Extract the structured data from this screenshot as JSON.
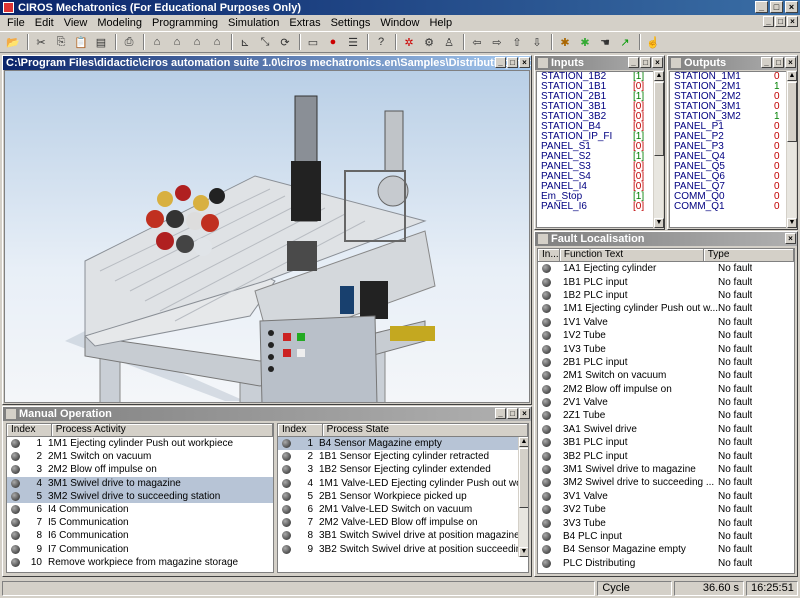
{
  "app": {
    "title": "CIROS Mechatronics (For Educational Purposes Only)"
  },
  "menu": [
    "File",
    "Edit",
    "View",
    "Modeling",
    "Programming",
    "Simulation",
    "Extras",
    "Settings",
    "Window",
    "Help"
  ],
  "toolbar_icons": [
    "open-folder-icon",
    "cut-icon",
    "copy-icon",
    "paste-icon",
    "paste-special-icon",
    "print-icon",
    "house-icon",
    "house-up-icon",
    "house-run-icon",
    "house-active-icon",
    "axes-icon",
    "axes-scale-icon",
    "axes-rotate-icon",
    "doc-icon",
    "stop-icon",
    "doc-list-icon",
    "help-pointer-icon",
    "robot-arm-icon",
    "gripper-icon",
    "robot-icon",
    "arrow-left-icon",
    "arrow-right-icon",
    "arrow-up-icon",
    "arrow-down-icon",
    "bug-icon",
    "bug-green-icon",
    "hand-wave-icon",
    "vector-icon",
    "hand-pointer-icon"
  ],
  "scene": {
    "title": "C:\\Program Files\\didactic\\ciros automation suite 1.0\\ciros mechatronics.en\\Samples\\DistributingStation..."
  },
  "inputs": {
    "title": "Inputs",
    "rows": [
      {
        "name": "STATION_1B2",
        "val": "[1]"
      },
      {
        "name": "STATION_1B1",
        "val": "[0]"
      },
      {
        "name": "STATION_2B1",
        "val": "[1]"
      },
      {
        "name": "STATION_3B1",
        "val": "[0]"
      },
      {
        "name": "STATION_3B2",
        "val": "[0]"
      },
      {
        "name": "STATION_B4",
        "val": "[0]"
      },
      {
        "name": "STATION_IP_FI",
        "val": "[1]"
      },
      {
        "name": "PANEL_S1",
        "val": "[0]"
      },
      {
        "name": "PANEL_S2",
        "val": "[1]"
      },
      {
        "name": "PANEL_S3",
        "val": "[0]"
      },
      {
        "name": "PANEL_S4",
        "val": "[0]"
      },
      {
        "name": "PANEL_I4",
        "val": "[0]"
      },
      {
        "name": "Em_Stop",
        "val": "[1]"
      },
      {
        "name": "PANEL_I6",
        "val": "[0]"
      }
    ]
  },
  "outputs": {
    "title": "Outputs",
    "rows": [
      {
        "name": "STATION_1M1",
        "val": "0"
      },
      {
        "name": "STATION_2M1",
        "val": "1"
      },
      {
        "name": "STATION_2M2",
        "val": "0"
      },
      {
        "name": "STATION_3M1",
        "val": "0"
      },
      {
        "name": "STATION_3M2",
        "val": "1"
      },
      {
        "name": "PANEL_P1",
        "val": "0"
      },
      {
        "name": "PANEL_P2",
        "val": "0"
      },
      {
        "name": "PANEL_P3",
        "val": "0"
      },
      {
        "name": "PANEL_Q4",
        "val": "0"
      },
      {
        "name": "PANEL_Q5",
        "val": "0"
      },
      {
        "name": "PANEL_Q6",
        "val": "0"
      },
      {
        "name": "PANEL_Q7",
        "val": "0"
      },
      {
        "name": "COMM_Q0",
        "val": "0"
      },
      {
        "name": "COMM_Q1",
        "val": "0"
      }
    ]
  },
  "fault": {
    "title": "Fault Localisation",
    "headers": [
      "In...",
      "Function Text",
      "Type"
    ],
    "rows": [
      {
        "fn": "1A1  Ejecting cylinder",
        "type": "No fault"
      },
      {
        "fn": "1B1  PLC input",
        "type": "No fault"
      },
      {
        "fn": "1B2  PLC input",
        "type": "No fault"
      },
      {
        "fn": "1M1  Ejecting cylinder Push out w...",
        "type": "No fault"
      },
      {
        "fn": "1V1  Valve",
        "type": "No fault"
      },
      {
        "fn": "1V2  Tube",
        "type": "No fault"
      },
      {
        "fn": "1V3  Tube",
        "type": "No fault"
      },
      {
        "fn": "2B1  PLC input",
        "type": "No fault"
      },
      {
        "fn": "2M1  Switch on vacuum",
        "type": "No fault"
      },
      {
        "fn": "2M2  Blow off impulse on",
        "type": "No fault"
      },
      {
        "fn": "2V1  Valve",
        "type": "No fault"
      },
      {
        "fn": "2Z1  Tube",
        "type": "No fault"
      },
      {
        "fn": "3A1  Swivel drive",
        "type": "No fault"
      },
      {
        "fn": "3B1  PLC input",
        "type": "No fault"
      },
      {
        "fn": "3B2  PLC input",
        "type": "No fault"
      },
      {
        "fn": "3M1  Swivel drive to magazine",
        "type": "No fault"
      },
      {
        "fn": "3M2  Swivel drive to succeeding ...",
        "type": "No fault"
      },
      {
        "fn": "3V1  Valve",
        "type": "No fault"
      },
      {
        "fn": "3V2  Tube",
        "type": "No fault"
      },
      {
        "fn": "3V3  Tube",
        "type": "No fault"
      },
      {
        "fn": "B4  PLC input",
        "type": "No fault"
      },
      {
        "fn": "B4  Sensor Magazine empty",
        "type": "No fault"
      },
      {
        "fn": "PLC Distributing",
        "type": "No fault"
      }
    ]
  },
  "manual": {
    "title": "Manual Operation",
    "activity_headers": [
      "Index",
      "Process Activity"
    ],
    "activity_rows": [
      {
        "i": "1",
        "t": "1M1  Ejecting cylinder Push out workpiece",
        "sel": false
      },
      {
        "i": "2",
        "t": "2M1  Switch on vacuum",
        "sel": false
      },
      {
        "i": "3",
        "t": "2M2  Blow off impulse on",
        "sel": false
      },
      {
        "i": "4",
        "t": "3M1  Swivel drive to magazine",
        "sel": true
      },
      {
        "i": "5",
        "t": "3M2  Swivel drive to succeeding station",
        "sel": true
      },
      {
        "i": "6",
        "t": "I4 Communication",
        "sel": false
      },
      {
        "i": "7",
        "t": "I5 Communication",
        "sel": false
      },
      {
        "i": "8",
        "t": "I6 Communication",
        "sel": false
      },
      {
        "i": "9",
        "t": "I7 Communication",
        "sel": false
      },
      {
        "i": "10",
        "t": "Remove workpiece from magazine storage",
        "sel": false
      }
    ],
    "state_headers": [
      "Index",
      "Process State"
    ],
    "state_rows": [
      {
        "i": "1",
        "t": "B4  Sensor Magazine empty",
        "sel": true
      },
      {
        "i": "2",
        "t": "1B1  Sensor Ejecting cylinder retracted",
        "sel": false
      },
      {
        "i": "3",
        "t": "1B2  Sensor Ejecting cylinder extended",
        "sel": false
      },
      {
        "i": "4",
        "t": "1M1  Valve-LED Ejecting cylinder Push out workpiec",
        "sel": false
      },
      {
        "i": "5",
        "t": "2B1  Sensor Workpiece picked up",
        "sel": false
      },
      {
        "i": "6",
        "t": "2M1  Valve-LED Switch on vacuum",
        "sel": false
      },
      {
        "i": "7",
        "t": "2M2  Valve-LED Blow off impulse on",
        "sel": false
      },
      {
        "i": "8",
        "t": "3B1  Switch Swivel drive at position magazine",
        "sel": false
      },
      {
        "i": "9",
        "t": "3B2  Switch Swivel drive at position succeeding stat",
        "sel": false
      }
    ]
  },
  "status": {
    "mode": "Cycle",
    "time": "36.60 s",
    "clock": "16:25:51"
  },
  "colors": {
    "active_title": "#0a246a",
    "inactive_title": "#808080",
    "on": "#008000",
    "off": "#c00000"
  }
}
